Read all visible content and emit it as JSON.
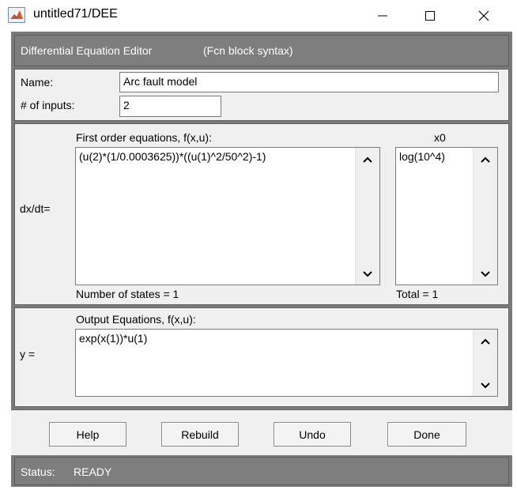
{
  "window": {
    "title": "untitled71/DEE",
    "controls": {
      "minimize": "—",
      "maximize": "☐",
      "close": "✕"
    }
  },
  "header": {
    "title": "Differential Equation Editor",
    "subtitle": "(Fcn block syntax)"
  },
  "form": {
    "name_label": "Name:",
    "name_value": "Arc fault model",
    "inputs_label": "# of inputs:",
    "inputs_value": "2"
  },
  "dx": {
    "row_label": "dx/dt=",
    "equations_label": "First order equations, f(x,u):",
    "equations_value": "(u(2)*(1/0.0003625))*((u(1)^2/50^2)-1)",
    "x0_label": "x0",
    "x0_value": "log(10^4)",
    "states_text": "Number of states = 1",
    "total_text": "Total = 1"
  },
  "output": {
    "row_label": "y =",
    "equations_label": "Output Equations, f(x,u):",
    "equations_value": "exp(x(1))*u(1)"
  },
  "buttons": {
    "help": "Help",
    "rebuild": "Rebuild",
    "undo": "Undo",
    "done": "Done"
  },
  "status": {
    "label": "Status:",
    "value": "READY"
  },
  "colors": {
    "gray_bar": "#7e7e7e",
    "panel_bg": "#f0f0f0",
    "matlab_icon": "#d9531e"
  },
  "icons": {
    "app": "matlab-icon",
    "scroll_up": "chevron-up-icon",
    "scroll_down": "chevron-down-icon"
  }
}
